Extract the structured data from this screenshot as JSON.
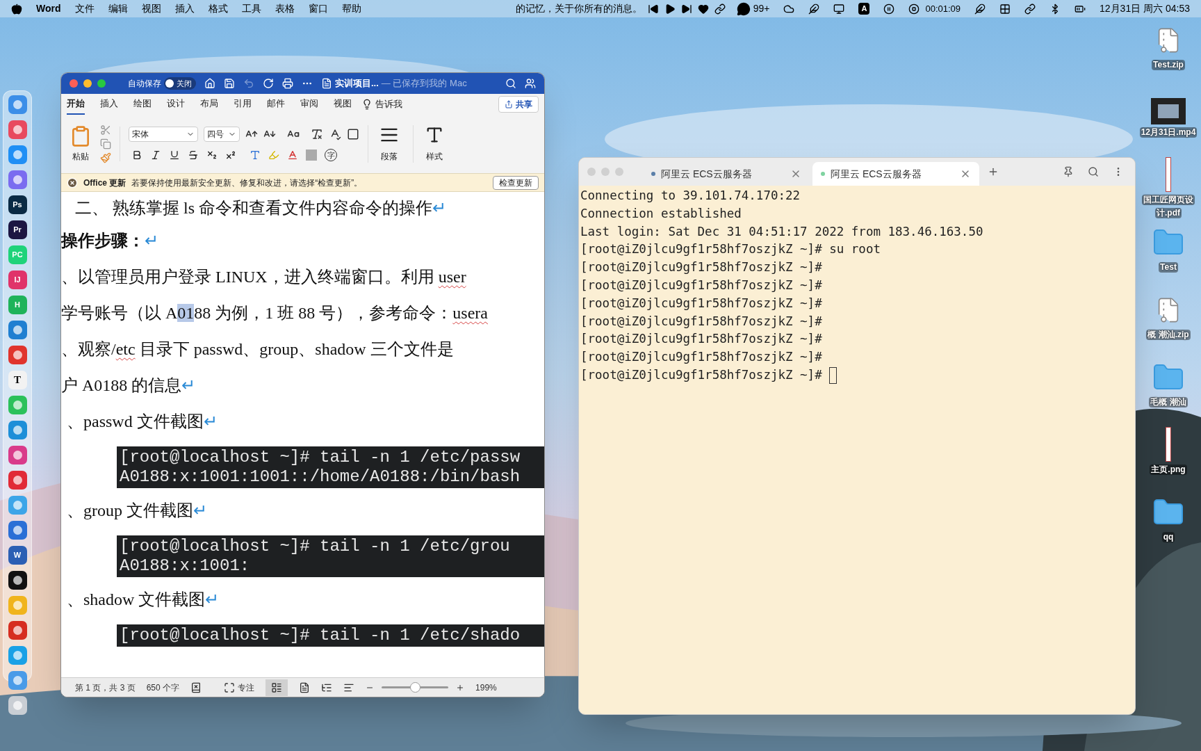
{
  "menu_bar": {
    "app": "Word",
    "items": [
      "文件",
      "编辑",
      "视图",
      "插入",
      "格式",
      "工具",
      "表格",
      "窗口",
      "帮助"
    ],
    "now_playing": "的记忆，关于你所有的消息。",
    "wechat_badge": "99+",
    "input_method": "A",
    "recording_time": "00:01:09",
    "clock": "12月31日 周六 04:53"
  },
  "dock": [
    {
      "color": "#3b8ee8"
    },
    {
      "color": "#e84a5f"
    },
    {
      "color": "#1f8ff5"
    },
    {
      "color": "#7a6cf0"
    },
    {
      "color": "#0a2a44",
      "glyph": "Ps"
    },
    {
      "color": "#1c1642",
      "glyph": "Pr"
    },
    {
      "color": "#1fd37a",
      "glyph": "PC"
    },
    {
      "color": "#e0336a",
      "glyph": "IJ"
    },
    {
      "color": "#1fb35a",
      "glyph": "H"
    },
    {
      "color": "#1f7fd1"
    },
    {
      "color": "#e0342d"
    },
    {
      "color": "#f2f2f2",
      "glyph": "T"
    },
    {
      "color": "#2bc15b"
    },
    {
      "color": "#1d8fd8"
    },
    {
      "color": "#d93a8a"
    },
    {
      "color": "#e12a36"
    },
    {
      "color": "#3da5e8"
    },
    {
      "color": "#2a6fd6"
    },
    {
      "color": "#2b5fb4",
      "glyph": "W"
    },
    {
      "color": "#111111"
    },
    {
      "color": "#f0b41c"
    },
    {
      "color": "#d62d20"
    },
    {
      "color": "#1aa1e6"
    },
    {
      "color": "#4a9be8"
    },
    {
      "color": "#c9ced4"
    }
  ],
  "word": {
    "autosave_label": "自动保存",
    "autosave": {
      "on": false,
      "label": "关闭"
    },
    "doc_title": "实训项目...",
    "save_status": "— 已保存到我的 Mac",
    "tabs": [
      {
        "label": "开始",
        "selected": true
      },
      {
        "label": "插入",
        "selected": false
      },
      {
        "label": "绘图",
        "selected": false
      },
      {
        "label": "设计",
        "selected": false
      },
      {
        "label": "布局",
        "selected": false
      },
      {
        "label": "引用",
        "selected": false
      },
      {
        "label": "邮件",
        "selected": false
      },
      {
        "label": "审阅",
        "selected": false
      },
      {
        "label": "视图",
        "selected": false
      }
    ],
    "tell_me": "告诉我",
    "share": "共享",
    "ribbon": {
      "paste": "粘贴",
      "font": "宋体",
      "size": "四号",
      "enclose_char": "字",
      "paragraph": "段落",
      "styles": "样式"
    },
    "update_bar": {
      "title": "Office 更新",
      "message": "若要保持使用最新安全更新、修复和改进，请选择“检查更新”。",
      "button": "检查更新"
    },
    "document": [
      {
        "kind": "heading",
        "segments": [
          {
            "text": "二、 熟练掌握 ls 命令和查看文件内容命令的操作",
            "selected": false,
            "misspelled": false
          }
        ],
        "mark": "↵"
      },
      {
        "kind": "bold",
        "segments": [
          {
            "text": "操作步骤：",
            "selected": false,
            "misspelled": false
          }
        ],
        "mark": "↵"
      },
      {
        "kind": "para",
        "segments": [
          {
            "text": "、以管理员用户登录 LINUX，进入终端窗口。利用 ",
            "selected": false,
            "misspelled": false
          },
          {
            "text": "user",
            "selected": false,
            "misspelled": true
          }
        ]
      },
      {
        "kind": "para",
        "segments": [
          {
            "text": "学号账号（以 A",
            "selected": false,
            "misspelled": false
          },
          {
            "text": "01",
            "selected": true,
            "misspelled": false
          },
          {
            "text": "88 为例，1 班 88 号），参考命令：",
            "selected": false,
            "misspelled": false
          },
          {
            "text": "usera",
            "selected": false,
            "misspelled": true
          }
        ]
      },
      {
        "kind": "para",
        "segments": [
          {
            "text": "、观察/",
            "selected": false,
            "misspelled": false
          },
          {
            "text": "etc",
            "selected": false,
            "misspelled": true
          },
          {
            "text": " 目录下 passwd、group、shadow 三个文件是",
            "selected": false,
            "misspelled": false
          }
        ]
      },
      {
        "kind": "para",
        "segments": [
          {
            "text": "户 A0188 的信息",
            "selected": false,
            "misspelled": false
          }
        ],
        "mark": "↵"
      },
      {
        "kind": "item",
        "segments": [
          {
            "text": "、passwd 文件截图",
            "selected": false,
            "misspelled": false
          }
        ],
        "mark": "↵"
      },
      {
        "kind": "code",
        "lines": [
          "[root@localhost ~]# tail -n 1 /etc/passw",
          "A0188:x:1001:1001::/home/A0188:/bin/bash"
        ]
      },
      {
        "kind": "item",
        "segments": [
          {
            "text": "、group 文件截图",
            "selected": false,
            "misspelled": false
          }
        ],
        "mark": "↵"
      },
      {
        "kind": "code",
        "lines": [
          "[root@localhost ~]# tail -n 1 /etc/grou",
          "A0188:x:1001:"
        ]
      },
      {
        "kind": "item",
        "segments": [
          {
            "text": "、shadow 文件截图",
            "selected": false,
            "misspelled": false
          }
        ],
        "mark": "↵"
      },
      {
        "kind": "code",
        "lines": [
          "[root@localhost ~]# tail -n 1 /etc/shado"
        ]
      }
    ],
    "status_bar": {
      "page": "第 1 页，共 3 页",
      "words": "650 个字",
      "focus": "专注",
      "zoom": {
        "level": 0.5,
        "label": "199%"
      }
    }
  },
  "terminal": {
    "tabs": [
      {
        "label": "阿里云 ECS云服务器",
        "selected": false,
        "color": "#5b7fa8"
      },
      {
        "label": "阿里云 ECS云服务器",
        "selected": true,
        "color": "#7fd3a0"
      }
    ],
    "lines": [
      "Connecting to 39.101.74.170:22",
      "Connection established",
      "Last login: Sat Dec 31 04:51:17 2022 from 183.46.163.50",
      "[root@iZ0jlcu9gf1r58hf7oszjkZ ~]# su root",
      "[root@iZ0jlcu9gf1r58hf7oszjkZ ~]#",
      "[root@iZ0jlcu9gf1r58hf7oszjkZ ~]#",
      "[root@iZ0jlcu9gf1r58hf7oszjkZ ~]#",
      "[root@iZ0jlcu9gf1r58hf7oszjkZ ~]#",
      "[root@iZ0jlcu9gf1r58hf7oszjkZ ~]#",
      "[root@iZ0jlcu9gf1r58hf7oszjkZ ~]#",
      "[root@iZ0jlcu9gf1r58hf7oszjkZ ~]# "
    ]
  },
  "desktop_icons": [
    {
      "kind": "zip",
      "label": [
        "Test.zip"
      ]
    },
    {
      "kind": "video",
      "label": [
        "12月31日.mp4"
      ]
    },
    {
      "kind": "doc",
      "label": [
        "国工匠网页设",
        "计.pdf"
      ]
    },
    {
      "kind": "folder",
      "label": [
        "Test"
      ]
    },
    {
      "kind": "zip",
      "label": [
        "概 潮汕.zip"
      ]
    },
    {
      "kind": "folder",
      "label": [
        "毛概 潮汕"
      ]
    },
    {
      "kind": "doc",
      "label": [
        "主页.png"
      ]
    },
    {
      "kind": "folder",
      "label": [
        "qq"
      ]
    }
  ]
}
